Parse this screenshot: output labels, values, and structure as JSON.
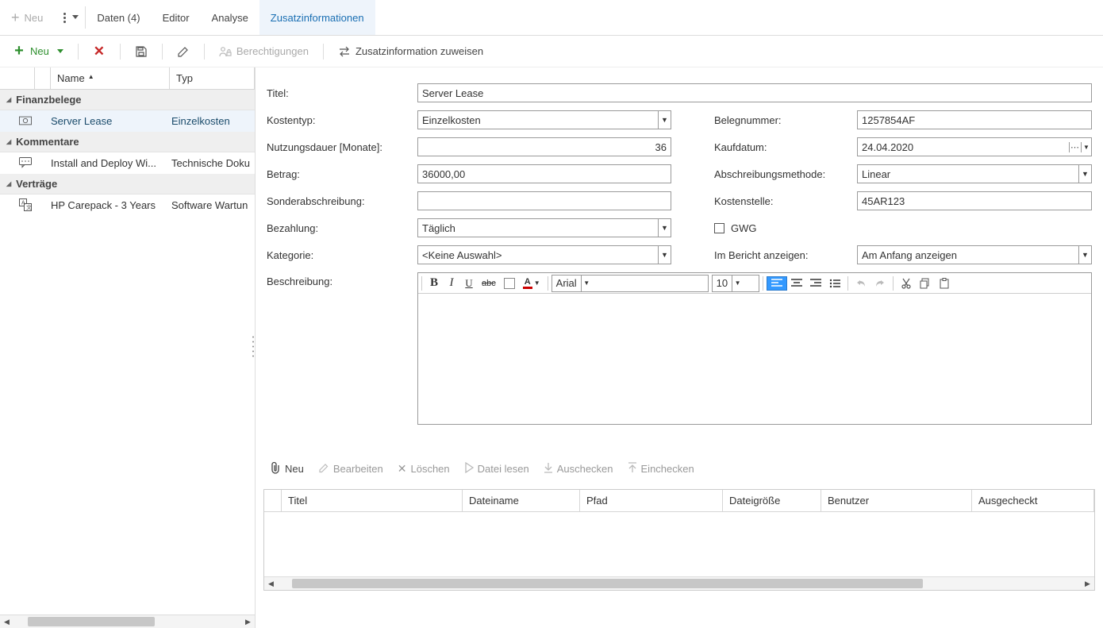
{
  "top": {
    "neu": "Neu",
    "tabs": [
      "Daten (4)",
      "Editor",
      "Analyse",
      "Zusatzinformationen"
    ],
    "activeTab": 3
  },
  "toolbar": {
    "neu": "Neu",
    "berechtigungen": "Berechtigungen",
    "zuweisen": "Zusatzinformation zuweisen"
  },
  "leftHeaders": {
    "name": "Name",
    "typ": "Typ"
  },
  "groups": [
    {
      "title": "Finanzbelege",
      "rows": [
        {
          "icon": "money",
          "name": "Server Lease",
          "type": "Einzelkosten",
          "selected": true
        }
      ]
    },
    {
      "title": "Kommentare",
      "rows": [
        {
          "icon": "comment",
          "name": "Install and Deploy Wi...",
          "type": "Technische Doku"
        }
      ]
    },
    {
      "title": "Verträge",
      "rows": [
        {
          "icon": "translate",
          "name": "HP Carepack - 3 Years",
          "type": "Software Wartun"
        }
      ]
    }
  ],
  "form": {
    "labels": {
      "titel": "Titel:",
      "kostentyp": "Kostentyp:",
      "nutzungsdauer": "Nutzungsdauer [Monate]:",
      "betrag": "Betrag:",
      "sonderabschreibung": "Sonderabschreibung:",
      "bezahlung": "Bezahlung:",
      "kategorie": "Kategorie:",
      "beschreibung": "Beschreibung:",
      "belegnummer": "Belegnummer:",
      "kaufdatum": "Kaufdatum:",
      "abschreibungsmethode": "Abschreibungsmethode:",
      "kostenstelle": "Kostenstelle:",
      "gwg": "GWG",
      "bericht": "Im Bericht anzeigen:"
    },
    "values": {
      "titel": "Server Lease",
      "kostentyp": "Einzelkosten",
      "nutzungsdauer": "36",
      "betrag": "36000,00",
      "sonderabschreibung": "",
      "bezahlung": "Täglich",
      "kategorie": "<Keine Auswahl>",
      "belegnummer": "1257854AF",
      "kaufdatum": "24.04.2020",
      "abschreibungsmethode": "Linear",
      "kostenstelle": "45AR123",
      "bericht": "Am Anfang anzeigen"
    },
    "rte": {
      "font": "Arial",
      "size": "10"
    }
  },
  "attach": {
    "buttons": {
      "neu": "Neu",
      "bearbeiten": "Bearbeiten",
      "loeschen": "Löschen",
      "datei": "Datei lesen",
      "auschecken": "Auschecken",
      "einchecken": "Einchecken"
    },
    "cols": [
      "Titel",
      "Dateiname",
      "Pfad",
      "Dateigröße",
      "Benutzer",
      "Ausgecheckt"
    ]
  }
}
